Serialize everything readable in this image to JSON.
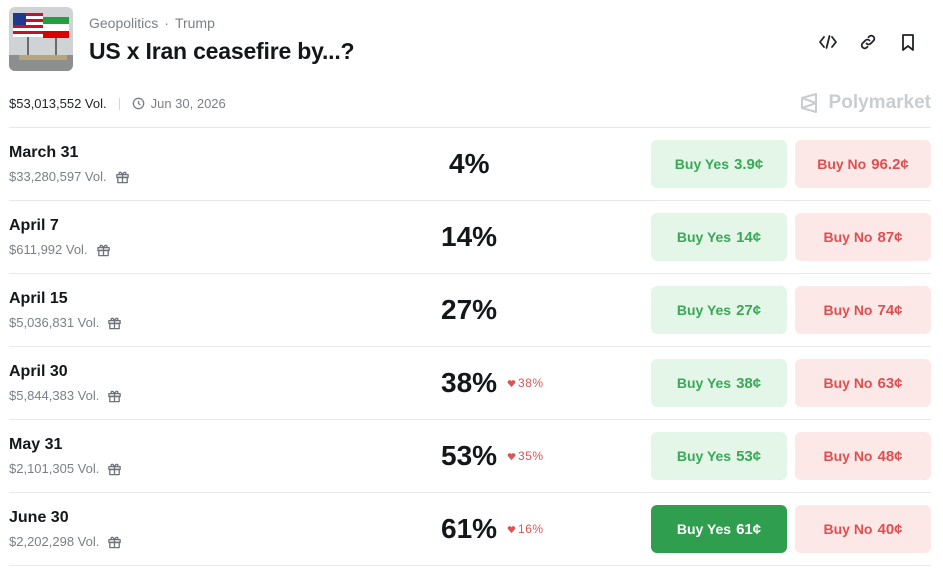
{
  "header": {
    "breadcrumb": [
      "Geopolitics",
      "Trump"
    ],
    "title": "US x Iran ceasefire by...?"
  },
  "meta": {
    "volume": "$53,013,552 Vol.",
    "end_date": "Jun 30, 2026"
  },
  "brand": {
    "name": "Polymarket"
  },
  "icons": {
    "embed": "code-icon",
    "link": "link-icon",
    "bookmark": "bookmark-icon",
    "calendar": "clock-icon",
    "gift": "gift-icon",
    "change": "heart-down-icon"
  },
  "colors": {
    "yes_bg": "#e3f6e8",
    "yes_text": "#3aa856",
    "yes_active": "#2f9e4f",
    "no_bg": "#fde8e8",
    "no_text": "#e04f4f",
    "change": "#e05252"
  },
  "markets": [
    {
      "label": "March 31",
      "volume": "$33,280,597 Vol.",
      "percent": "4%",
      "change": "",
      "yes_text": "Buy Yes",
      "yes_price": "3.9¢",
      "no_text": "Buy No",
      "no_price": "96.2¢",
      "selected": false
    },
    {
      "label": "April 7",
      "volume": "$611,992 Vol.",
      "percent": "14%",
      "change": "",
      "yes_text": "Buy Yes",
      "yes_price": "14¢",
      "no_text": "Buy No",
      "no_price": "87¢",
      "selected": false
    },
    {
      "label": "April 15",
      "volume": "$5,036,831 Vol.",
      "percent": "27%",
      "change": "",
      "yes_text": "Buy Yes",
      "yes_price": "27¢",
      "no_text": "Buy No",
      "no_price": "74¢",
      "selected": false
    },
    {
      "label": "April 30",
      "volume": "$5,844,383 Vol.",
      "percent": "38%",
      "change": "38%",
      "yes_text": "Buy Yes",
      "yes_price": "38¢",
      "no_text": "Buy No",
      "no_price": "63¢",
      "selected": false
    },
    {
      "label": "May 31",
      "volume": "$2,101,305 Vol.",
      "percent": "53%",
      "change": "35%",
      "yes_text": "Buy Yes",
      "yes_price": "53¢",
      "no_text": "Buy No",
      "no_price": "48¢",
      "selected": false
    },
    {
      "label": "June 30",
      "volume": "$2,202,298 Vol.",
      "percent": "61%",
      "change": "16%",
      "yes_text": "Buy Yes",
      "yes_price": "61¢",
      "no_text": "Buy No",
      "no_price": "40¢",
      "selected": true
    }
  ]
}
